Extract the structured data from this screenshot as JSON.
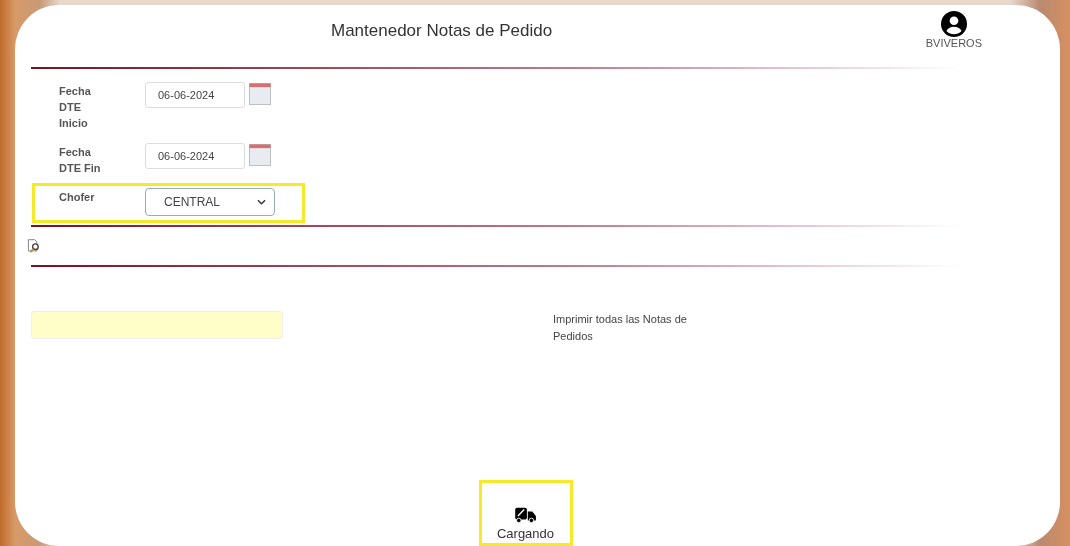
{
  "header": {
    "title": "Mantenedor Notas de Pedido",
    "user": "BVIVEROS"
  },
  "filters": [
    {
      "kind": "date",
      "label": "Fecha DTE Inicio",
      "value": "06-06-2024",
      "highlighted": false
    },
    {
      "kind": "date",
      "label": "Fecha DTE Fin",
      "value": "06-06-2024",
      "highlighted": false
    },
    {
      "kind": "select",
      "label": "Chofer",
      "value": "CENTRAL",
      "highlighted": true
    }
  ],
  "print_all": {
    "label": "Imprimir todas las Notas de Pedidos"
  },
  "footer_button": {
    "label": "Cargando",
    "highlighted": true
  }
}
